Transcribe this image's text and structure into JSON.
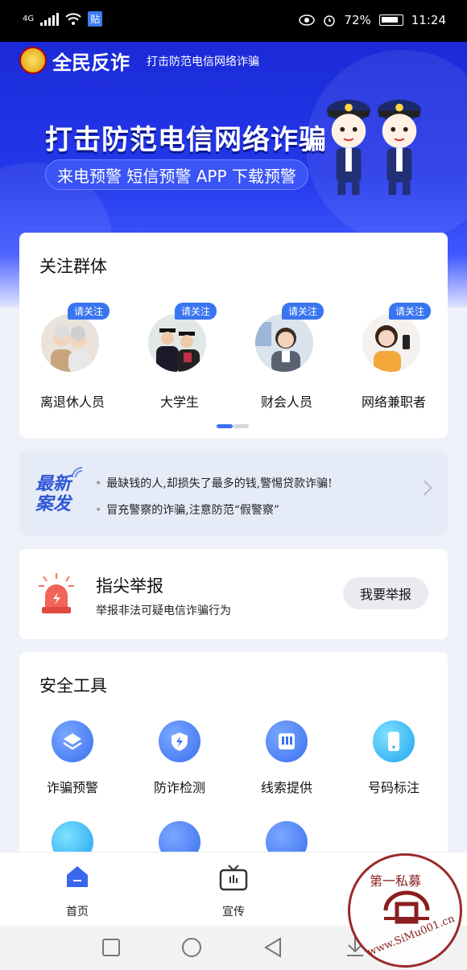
{
  "status_bar": {
    "network": "4G",
    "pay": "贴",
    "battery": "72%",
    "time": "11:24"
  },
  "header": {
    "brand": "全民反诈",
    "slogan": "打击防范电信网络诈骗"
  },
  "banner": {
    "title": "打击防范电信网络诈骗",
    "subtitle": "来电预警  短信预警  APP 下载预警"
  },
  "groups": {
    "title": "关注群体",
    "tag": "请关注",
    "items": [
      {
        "label": "离退休人员"
      },
      {
        "label": "大学生"
      },
      {
        "label": "财会人员"
      },
      {
        "label": "网络兼职者"
      }
    ],
    "page_count": 2,
    "active_page": 1
  },
  "news": {
    "badge_line1": "最新",
    "badge_line2": "案发",
    "bullet": "•",
    "items": [
      "最缺钱的人,却损失了最多的钱,警惕贷款诈骗!",
      "冒充警察的诈骗,注意防范“假警察”"
    ]
  },
  "report": {
    "title": "指尖举报",
    "subtitle": "举报非法可疑电信诈骗行为",
    "button": "我要举报"
  },
  "tools": {
    "title": "安全工具",
    "items": [
      {
        "label": "诈骗预警",
        "icon": "layers-icon"
      },
      {
        "label": "防诈检测",
        "icon": "shield-bolt-icon"
      },
      {
        "label": "线索提供",
        "icon": "book-icon"
      },
      {
        "label": "号码标注",
        "icon": "phone-icon"
      }
    ]
  },
  "tabbar": {
    "items": [
      {
        "label": "首页",
        "icon": "home-icon"
      },
      {
        "label": "宣传",
        "icon": "tv-icon"
      }
    ]
  },
  "watermark": {
    "top_text": "第一私募",
    "url": "www.SiMu001.cn"
  },
  "colors": {
    "primary": "#3975f0",
    "banner": "#2438ea",
    "alert": "#e84a3a"
  }
}
